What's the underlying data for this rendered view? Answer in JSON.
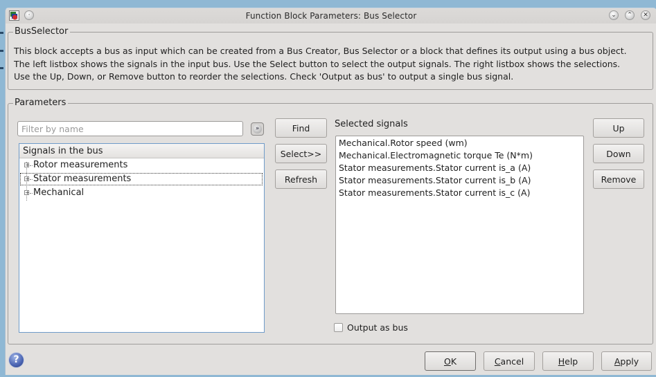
{
  "window": {
    "title": "Function Block Parameters: Bus Selector",
    "buttons": {
      "minimize": "⌄",
      "maximize": "⌃",
      "close": "✕"
    }
  },
  "description_group": {
    "label": "BusSelector",
    "lines": [
      "This block accepts a bus as input which can be created from a Bus Creator, Bus Selector or a block that defines its output using a bus object.",
      "The left listbox shows the signals in the input bus. Use the Select button to select the output signals. The right listbox shows the selections.",
      "Use the Up, Down, or Remove button to reorder the selections. Check 'Output as bus' to output a single bus signal."
    ]
  },
  "parameters_group": {
    "label": "Parameters",
    "filter": {
      "placeholder": "Filter by name",
      "value": ""
    },
    "filter_options_icon": "double-chevron-down-icon",
    "tree": {
      "header": "Signals in the bus",
      "items": [
        {
          "label": "Rotor measurements",
          "expanded": false,
          "focused": false
        },
        {
          "label": "Stator measurements",
          "expanded": false,
          "focused": true
        },
        {
          "label": "Mechanical",
          "expanded": false,
          "focused": false
        }
      ]
    },
    "middle_buttons": {
      "find": "Find",
      "select": "Select>>",
      "refresh": "Refresh"
    },
    "selected_signals": {
      "label": "Selected signals",
      "items": [
        "Mechanical.Rotor speed (wm)",
        "Mechanical.Electromagnetic torque Te (N*m)",
        "Stator measurements.Stator current is_a (A)",
        "Stator measurements.Stator current is_b (A)",
        "Stator measurements.Stator current is_c (A)"
      ]
    },
    "right_buttons": {
      "up": "Up",
      "down": "Down",
      "remove": "Remove"
    },
    "output_as_bus": {
      "label": "Output as bus",
      "checked": false
    }
  },
  "footer": {
    "ok": {
      "mnemonic": "O",
      "rest": "K"
    },
    "cancel": {
      "mnemonic": "C",
      "rest": "ancel"
    },
    "help": {
      "mnemonic": "H",
      "rest": "elp"
    },
    "apply": {
      "mnemonic": "A",
      "rest": "pply"
    },
    "help_icon": "?"
  }
}
